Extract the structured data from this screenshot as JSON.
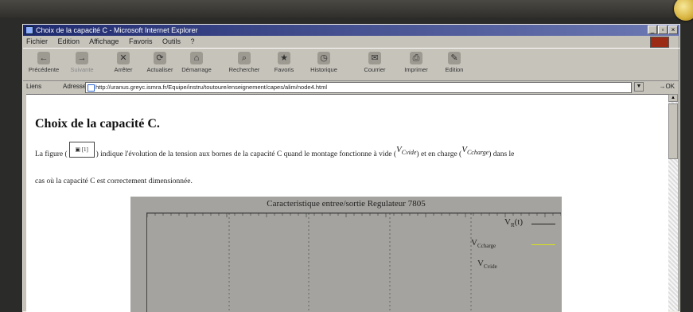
{
  "window": {
    "title": "Choix de la capacité C - Microsoft Internet Explorer",
    "controls": [
      "_",
      "▫",
      "×"
    ]
  },
  "menu": [
    "Fichier",
    "Edition",
    "Affichage",
    "Favoris",
    "Outils",
    "?"
  ],
  "toolbar": {
    "back": "Précédente",
    "forward": "Suivante",
    "stop": "Arrêter",
    "refresh": "Actualiser",
    "home": "Démarrage",
    "search": "Rechercher",
    "favorites": "Favoris",
    "history": "Historique",
    "mail": "Courrier",
    "print": "Imprimer",
    "edit": "Edition"
  },
  "address": {
    "links_label": "Liens",
    "label": "Adresse",
    "url": "http://uranus.greyc.ismra.fr/Equipe/instru/toutoure/enseignement/capes/alim/node4.html",
    "go": "OK"
  },
  "page": {
    "heading": "Choix de la capacité C.",
    "para1_a": "La figure (",
    "fig_ref": "[1]",
    "para1_b": ") indique l'évolution de la tension aux bornes de la capacité C quand le montage fonctionne à vide (",
    "v_cvide_v": "V",
    "v_cvide_sub": "Cvide",
    "para1_c": ") et en charge (",
    "v_ccharge_v": "V",
    "v_ccharge_sub": "Ccharge",
    "para1_d": ") dans le",
    "para2": "cas où la capacité C est correctement dimensionnée."
  },
  "chart": {
    "title": "Caracteristique entree/sortie Regulateur 7805",
    "legend": [
      {
        "sym": "V",
        "sub": "R",
        "label": "(t)",
        "color": "#222222"
      },
      {
        "sym": "V",
        "sub": "Ccharge",
        "label": "",
        "color": "#d8e21a"
      },
      {
        "sym": "V",
        "sub": "Cvide",
        "label": "",
        "color": "#222222"
      }
    ]
  }
}
